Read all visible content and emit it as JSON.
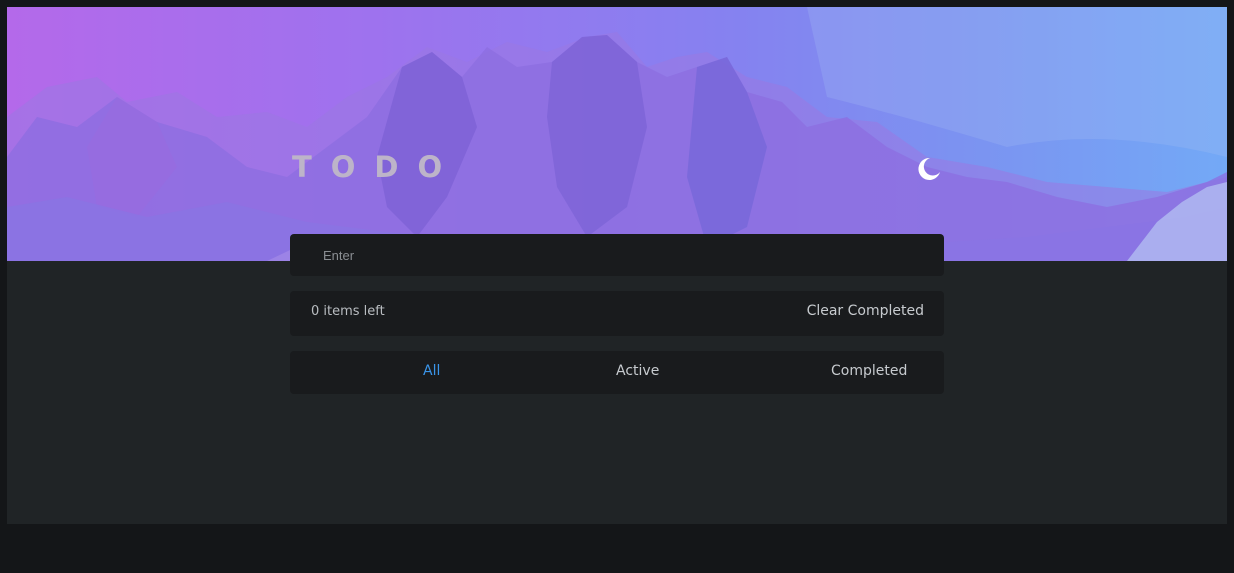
{
  "app": {
    "title": "TODO"
  },
  "header": {
    "theme_toggle_icon": "moon-icon"
  },
  "new_todo": {
    "placeholder": "Enter",
    "value": ""
  },
  "status": {
    "items_left": "0 items left",
    "clear_label": "Clear Completed"
  },
  "filters": {
    "items": [
      {
        "label": "All",
        "active": true
      },
      {
        "label": "Active",
        "active": false
      },
      {
        "label": "Completed",
        "active": false
      }
    ]
  },
  "colors": {
    "gradient_start": "#b469ea",
    "gradient_end": "#73a9f6",
    "accent": "#3a95ea",
    "panel_bg": "#191b1d",
    "page_bg": "#202426"
  }
}
